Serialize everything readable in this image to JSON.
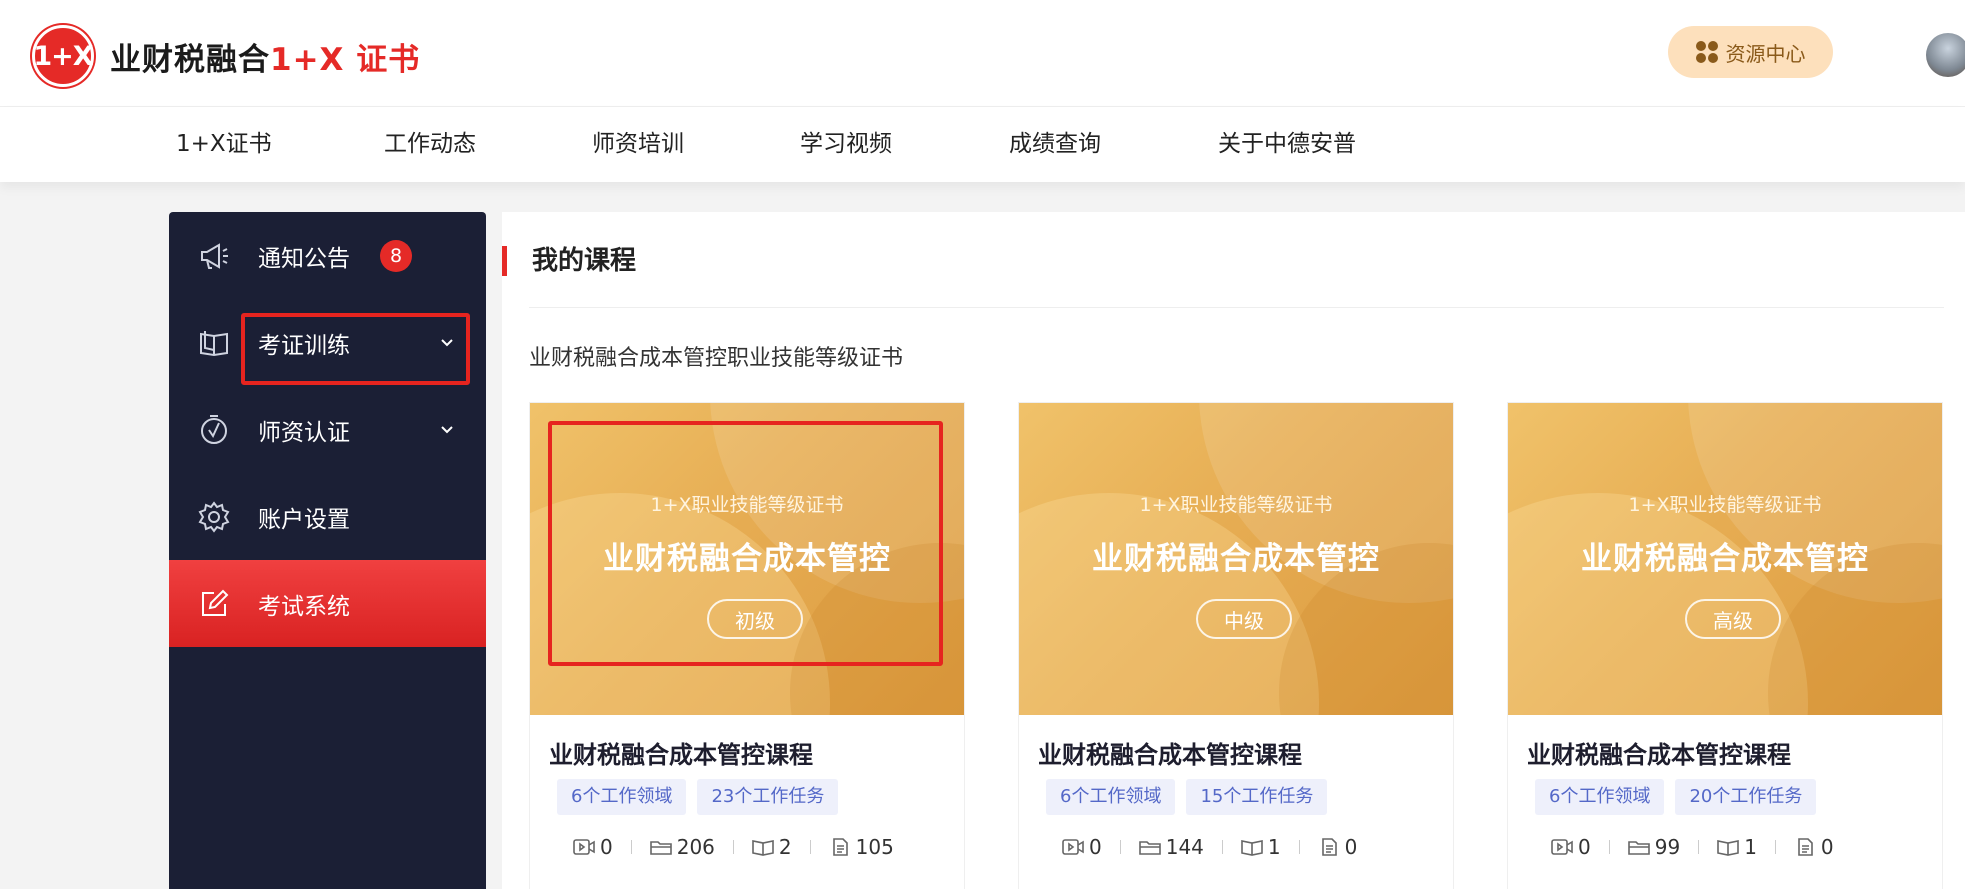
{
  "header": {
    "logo_badge": "1+X",
    "logo_name": "业财税融合",
    "logo_suffix": "1+X 证书",
    "resource_button": "资源中心"
  },
  "nav": [
    "1+X证书",
    "工作动态",
    "师资培训",
    "学习视频",
    "成绩查询",
    "关于中德安普"
  ],
  "sidebar": {
    "items": [
      {
        "label": "通知公告",
        "badge": "8"
      },
      {
        "label": "考证训练"
      },
      {
        "label": "师资认证"
      },
      {
        "label": "账户设置"
      },
      {
        "label": "考试系统"
      }
    ],
    "active_index": 4
  },
  "main": {
    "title": "我的课程",
    "cert_title": "业财税融合成本管控职业技能等级证书",
    "courses": [
      {
        "cover_subtitle": "1+X职业技能等级证书",
        "cover_title": "业财税融合成本管控",
        "level": "初级",
        "name": "业财税融合成本管控课程",
        "tags": [
          "6个工作领域",
          "23个工作任务"
        ],
        "stats": {
          "video": "0",
          "cases": "206",
          "books": "2",
          "docs": "105"
        }
      },
      {
        "cover_subtitle": "1+X职业技能等级证书",
        "cover_title": "业财税融合成本管控",
        "level": "中级",
        "name": "业财税融合成本管控课程",
        "tags": [
          "6个工作领域",
          "15个工作任务"
        ],
        "stats": {
          "video": "0",
          "cases": "144",
          "books": "1",
          "docs": "0"
        }
      },
      {
        "cover_subtitle": "1+X职业技能等级证书",
        "cover_title": "业财税融合成本管控",
        "level": "高级",
        "name": "业财税融合成本管控课程",
        "tags": [
          "6个工作领域",
          "20个工作任务"
        ],
        "stats": {
          "video": "0",
          "cases": "99",
          "books": "1",
          "docs": "0"
        }
      }
    ]
  },
  "colors": {
    "accent": "#e52a27",
    "sidebar_bg": "#1b1f35",
    "tag_text": "#5468c8",
    "cover": "#e6ac52"
  }
}
